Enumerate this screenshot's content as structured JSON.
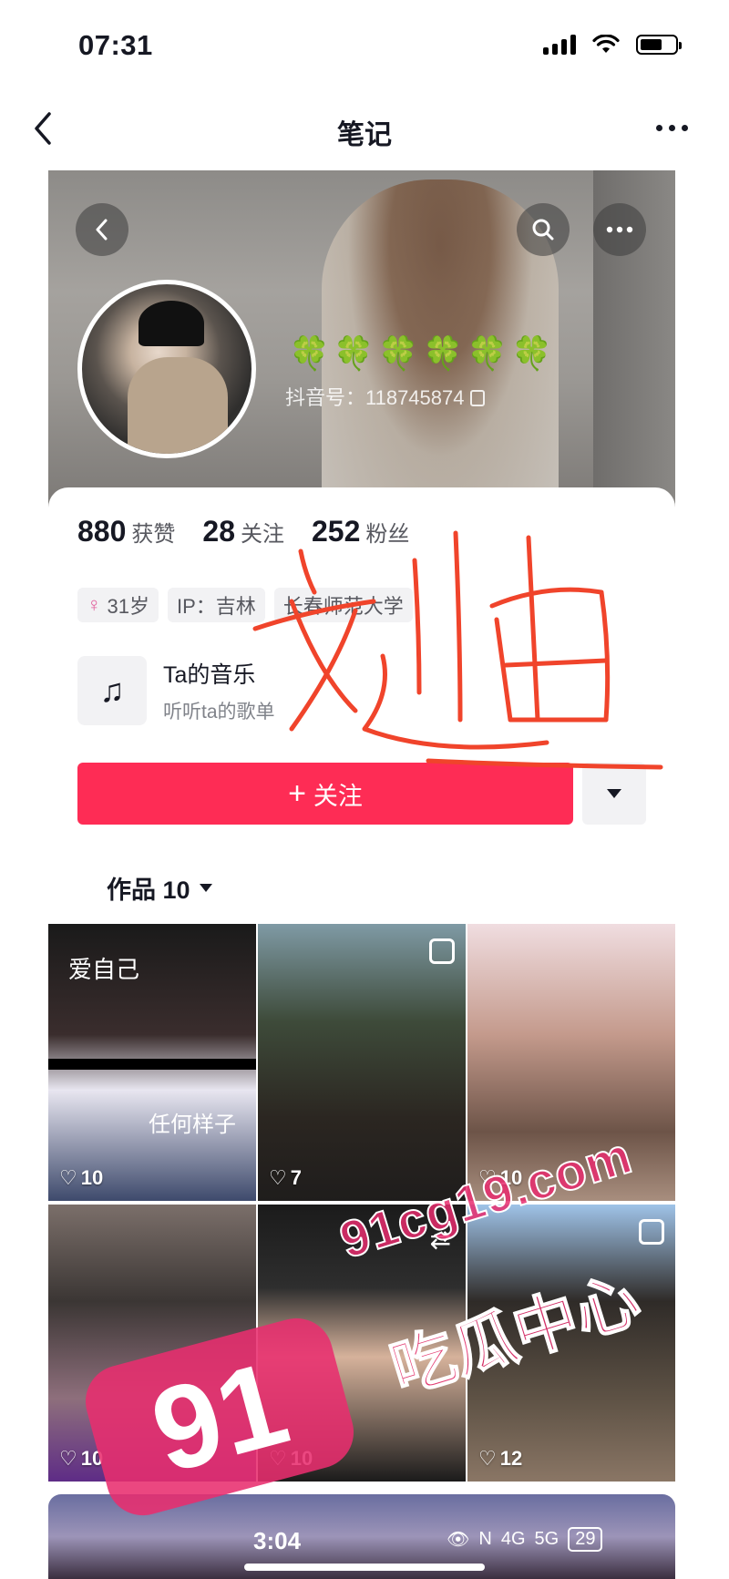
{
  "status_bar": {
    "time": "07:31",
    "battery_level": 0.65
  },
  "nav": {
    "title": "笔记"
  },
  "profile": {
    "clovers": "🍀🍀🍀🍀🍀🍀",
    "douyin_id": "抖音号：118745874",
    "stats": [
      {
        "value": "880",
        "label": "获赞"
      },
      {
        "value": "28",
        "label": "关注"
      },
      {
        "value": "252",
        "label": "粉丝"
      }
    ],
    "tags": {
      "gender_symbol": "♀",
      "age": "31岁",
      "ip": "IP：吉林",
      "school": "长春师范大学"
    },
    "music": {
      "title": "Ta的音乐",
      "subtitle": "听听ta的歌单"
    },
    "follow_label": "关注",
    "handwriting": "刘迪"
  },
  "works": {
    "tab_label": "作品 10",
    "items": [
      {
        "likes": "10",
        "overlay_top": "爱自己",
        "overlay_bottom": "任何样子"
      },
      {
        "likes": "7"
      },
      {
        "likes": "10"
      },
      {
        "likes": "10"
      },
      {
        "likes": "10"
      },
      {
        "likes": "12"
      }
    ]
  },
  "bottom_overlay": {
    "time": "3:04",
    "network": "4G",
    "network2": "5G",
    "battery": "29"
  },
  "watermark": {
    "domain": "91cg19.com",
    "name": "吃瓜中心",
    "logo": "91"
  },
  "colors": {
    "accent": "#fe2c55",
    "watermark": "#e82d6e"
  }
}
